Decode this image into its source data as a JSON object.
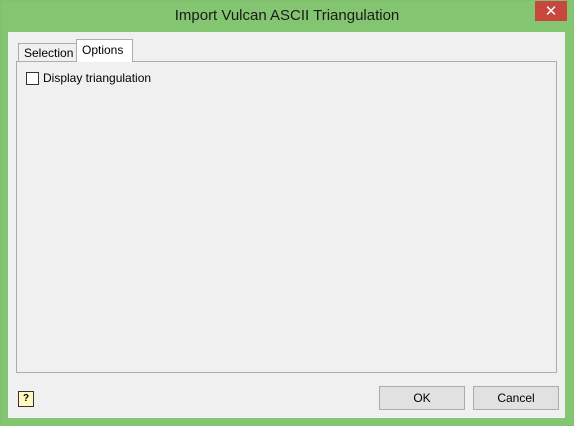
{
  "window": {
    "title": "Import Vulcan ASCII Triangulation",
    "close_glyph": "✕"
  },
  "tabs": [
    {
      "label": "Selection",
      "selected": false
    },
    {
      "label": "Options",
      "selected": true
    }
  ],
  "options": {
    "display_triangulation_label": "Display triangulation",
    "display_triangulation_checked": false
  },
  "footer": {
    "help_glyph": "?",
    "ok_label": "OK",
    "cancel_label": "Cancel"
  },
  "colors": {
    "titlebar": "#84c571",
    "close": "#c7463d",
    "client": "#f0f0f0"
  }
}
